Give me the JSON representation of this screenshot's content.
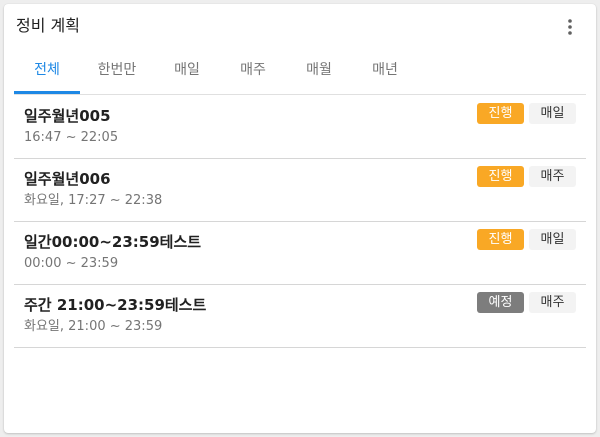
{
  "card": {
    "title": "정비 계획",
    "menu_icon": "more-vert-icon"
  },
  "tabs": [
    {
      "label": "전체",
      "active": true
    },
    {
      "label": "한번만",
      "active": false
    },
    {
      "label": "매일",
      "active": false
    },
    {
      "label": "매주",
      "active": false
    },
    {
      "label": "매월",
      "active": false
    },
    {
      "label": "매년",
      "active": false
    }
  ],
  "colors": {
    "accent": "#1e88e5",
    "status_in_progress": "#f9a825",
    "status_scheduled": "#7d7d7d"
  },
  "items": [
    {
      "title": "일주월년005",
      "subtitle": "16:47 ~ 22:05",
      "status": "진행",
      "status_type": "in_progress",
      "frequency": "매일"
    },
    {
      "title": "일주월년006",
      "subtitle": "화요일, 17:27 ~ 22:38",
      "status": "진행",
      "status_type": "in_progress",
      "frequency": "매주"
    },
    {
      "title": "일간00:00~23:59테스트",
      "subtitle": "00:00 ~ 23:59",
      "status": "진행",
      "status_type": "in_progress",
      "frequency": "매일"
    },
    {
      "title": "주간 21:00~23:59테스트",
      "subtitle": "화요일, 21:00 ~ 23:59",
      "status": "예정",
      "status_type": "scheduled",
      "frequency": "매주"
    }
  ]
}
